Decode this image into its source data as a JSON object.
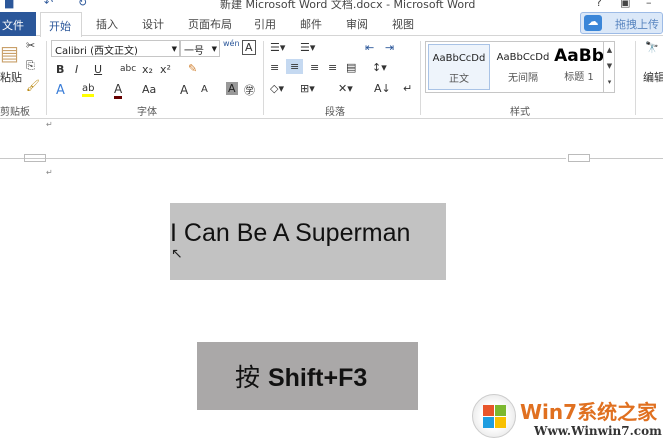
{
  "window": {
    "title": "新建 Microsoft Word 文档.docx - Microsoft Word"
  },
  "tabs": {
    "file": "文件",
    "items": [
      "开始",
      "插入",
      "设计",
      "页面布局",
      "引用",
      "邮件",
      "审阅",
      "视图"
    ]
  },
  "upload": {
    "label": "拖拽上传"
  },
  "ribbon": {
    "clipboard": {
      "paste": "粘贴",
      "label": "剪贴板"
    },
    "font": {
      "name": "Calibri (西文正文)",
      "size": "一号",
      "label": "字体",
      "bold": "B",
      "italic": "I",
      "underline": "U",
      "strike": "abc",
      "sub": "x₂",
      "sup": "x²",
      "case": "Aa",
      "grow": "A",
      "shrink": "A"
    },
    "paragraph": {
      "label": "段落"
    },
    "styles": {
      "label": "样式",
      "items": [
        {
          "preview": "AaBbCcDd",
          "name": "正文"
        },
        {
          "preview": "AaBbCcDd",
          "name": "无间隔"
        },
        {
          "preview": "AaBb",
          "name": "标题 1"
        }
      ]
    },
    "editing": {
      "label": "编辑"
    }
  },
  "document": {
    "line1": "I Can Be A Superman",
    "line2_prefix": "按 ",
    "line2_keys": "Shift+F3"
  },
  "watermark": {
    "brand": "Win7系统之家",
    "url": "Www.Winwin7.com"
  }
}
